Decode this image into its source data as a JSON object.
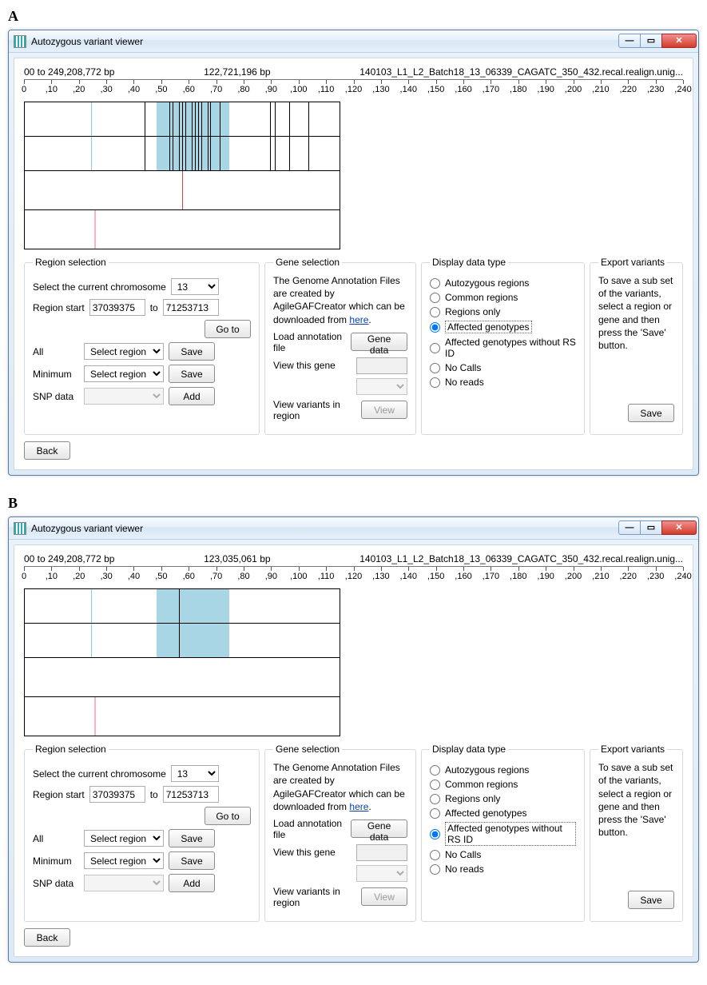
{
  "labels": {
    "panelA": "A",
    "panelB": "B"
  },
  "region_selection": {
    "legend": "Region selection",
    "select_chrom_label": "Select the current chromosome",
    "chromosome": "13",
    "region_start_label": "Region start",
    "region_start": "37039375",
    "to_label": "to",
    "region_end": "71253713",
    "goto_btn": "Go to",
    "all_label": "All",
    "min_label": "Minimum",
    "snp_label": "SNP data",
    "select_region": "Select region",
    "save_btn": "Save",
    "add_btn": "Add",
    "back_btn": "Back"
  },
  "gene_selection": {
    "legend": "Gene selection",
    "desc_prefix": "The Genome Annotation Files are created by AgileGAFCreator which can be downloaded from ",
    "desc_link": "here",
    "desc_suffix": ".",
    "load_label": "Load annotation file",
    "genedata_btn": "Gene data",
    "view_gene_label": "View this gene",
    "view_variants_label": "View variants in region",
    "view_btn": "View"
  },
  "display": {
    "legend": "Display data type",
    "options": [
      "Autozygous regions",
      "Common regions",
      "Regions only",
      "Affected genotypes",
      "Affected genotypes without RS ID",
      "No Calls",
      "No reads"
    ]
  },
  "export": {
    "legend": "Export variants",
    "desc": "To save a sub set of the variants, select a region or gene and then press the 'Save' button.",
    "save_btn": "Save"
  },
  "ruler": {
    "ticks": [
      "0",
      "10",
      "20",
      "30",
      "40",
      "50",
      "60",
      "70",
      "80",
      "90",
      "100",
      "110",
      "120",
      "130",
      "140",
      "150",
      "160",
      "170",
      "180",
      "190",
      "200",
      "210",
      "220",
      "230",
      "240"
    ]
  },
  "panelA": {
    "window_title": "Autozygous  variant viewer",
    "range_text": "00 to 249,208,772 bp",
    "center_text": "122,721,196 bp",
    "sample_text": "140103_L1_L2_Batch18_13_06339_CAGATC_350_432.recal.realign.unig...",
    "selected_display_index": 3,
    "trackset": "dense"
  },
  "panelB": {
    "window_title": "Autozygous  variant viewer",
    "range_text": "00 to 249,208,772 bp",
    "center_text": "123,035,061 bp",
    "sample_text": "140103_L1_L2_Batch18_13_06339_CAGATC_350_432.recal.realign.unig...",
    "selected_display_index": 4,
    "trackset": "sparse"
  }
}
